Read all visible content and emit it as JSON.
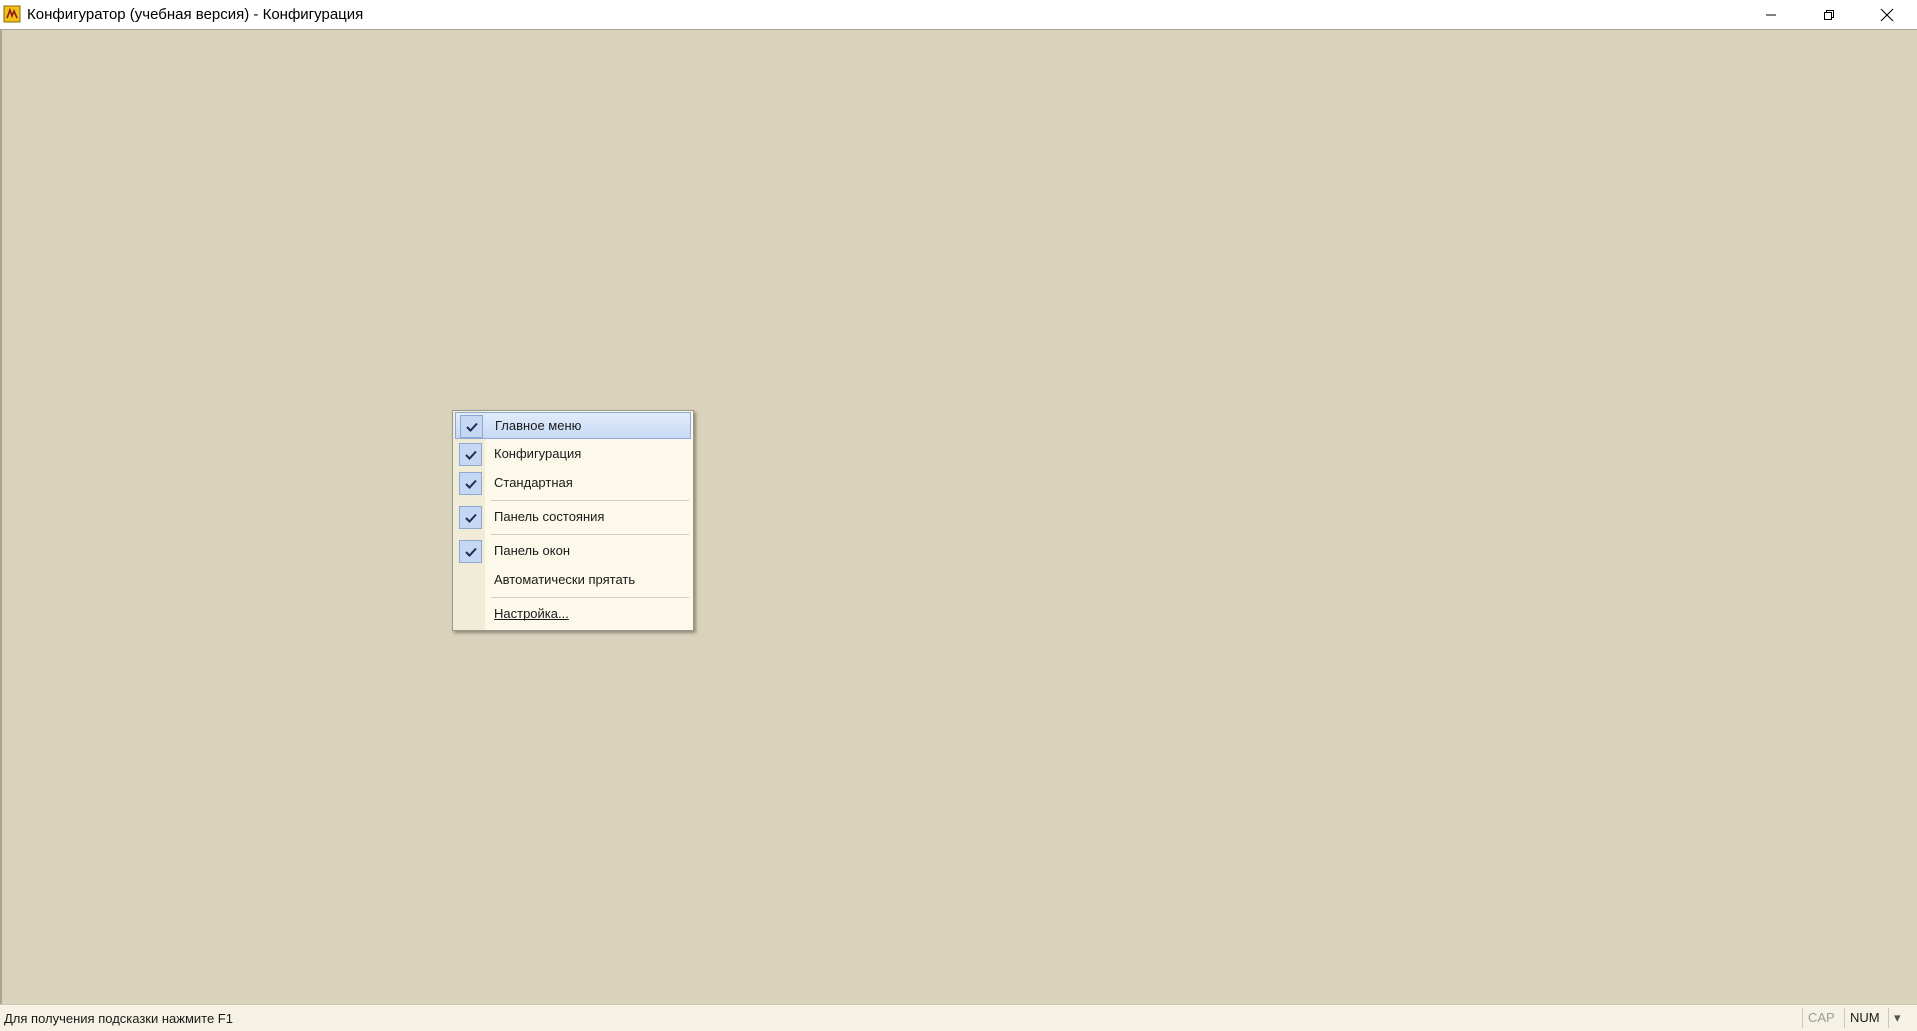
{
  "window": {
    "title": "Конфигуратор (учебная версия) - Конфигурация"
  },
  "context_menu": {
    "items": [
      {
        "label": "Главное меню",
        "checked": true,
        "highlighted": true
      },
      {
        "label": "Конфигурация",
        "checked": true
      },
      {
        "label": "Стандартная",
        "checked": true
      },
      {
        "label": "Панель состояния",
        "checked": true
      },
      {
        "label": "Панель окон",
        "checked": true
      },
      {
        "label": "Автоматически прятать",
        "checked": false
      },
      {
        "label": "Настройка...",
        "checked": false
      }
    ]
  },
  "statusbar": {
    "hint": "Для получения подсказки нажмите F1",
    "cap": "CAP",
    "num": "NUM",
    "menu_arrow": "▾"
  },
  "colors": {
    "workspace": "#d9d3bc",
    "menu_background": "#fcf8ea",
    "highlight": "#c7d9f4",
    "check_box": "#c4d7f3"
  },
  "icons": {
    "app": "1c-app-icon",
    "minimize": "minimize-icon",
    "maximize": "restore-icon",
    "close": "close-icon",
    "check": "checkmark-icon"
  }
}
